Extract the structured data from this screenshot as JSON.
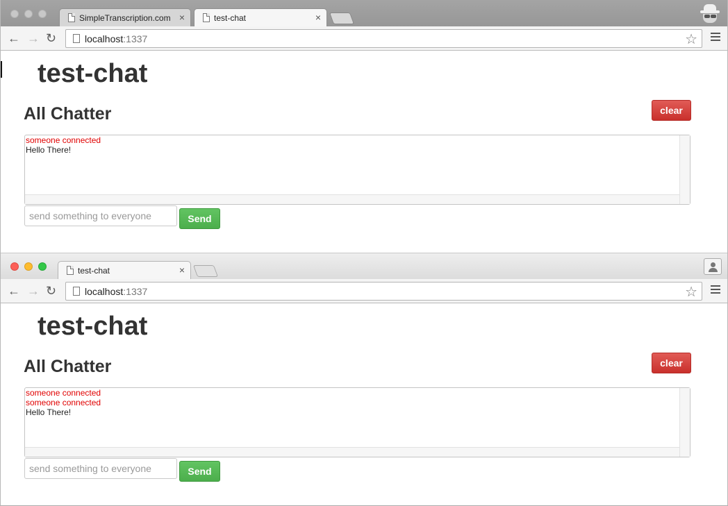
{
  "window1": {
    "tabs": [
      {
        "title": "SimpleTranscription.com",
        "close": "×"
      },
      {
        "title": "test-chat",
        "close": "×"
      }
    ],
    "url_host": "localhost",
    "url_port": ":1337",
    "app_title": "test-chat",
    "section_title": "All Chatter",
    "clear_label": "clear",
    "messages": [
      {
        "text": "someone connected",
        "kind": "system"
      },
      {
        "text": "Hello There!",
        "kind": "message"
      }
    ],
    "input_placeholder": "send something to everyone",
    "send_label": "Send"
  },
  "window2": {
    "tabs": [
      {
        "title": "test-chat",
        "close": "×"
      }
    ],
    "url_host": "localhost",
    "url_port": ":1337",
    "app_title": "test-chat",
    "section_title": "All Chatter",
    "clear_label": "clear",
    "messages": [
      {
        "text": "someone connected",
        "kind": "system"
      },
      {
        "text": "someone connected",
        "kind": "system"
      },
      {
        "text": "Hello There!",
        "kind": "message"
      }
    ],
    "input_placeholder": "send something to everyone",
    "send_label": "Send"
  },
  "icons": {
    "back": "←",
    "forward": "→",
    "reload": "↻",
    "star": "☆"
  },
  "colors": {
    "clear_button": "#d9534f",
    "send_button": "#5cb85c",
    "system_message": "#e00000"
  }
}
